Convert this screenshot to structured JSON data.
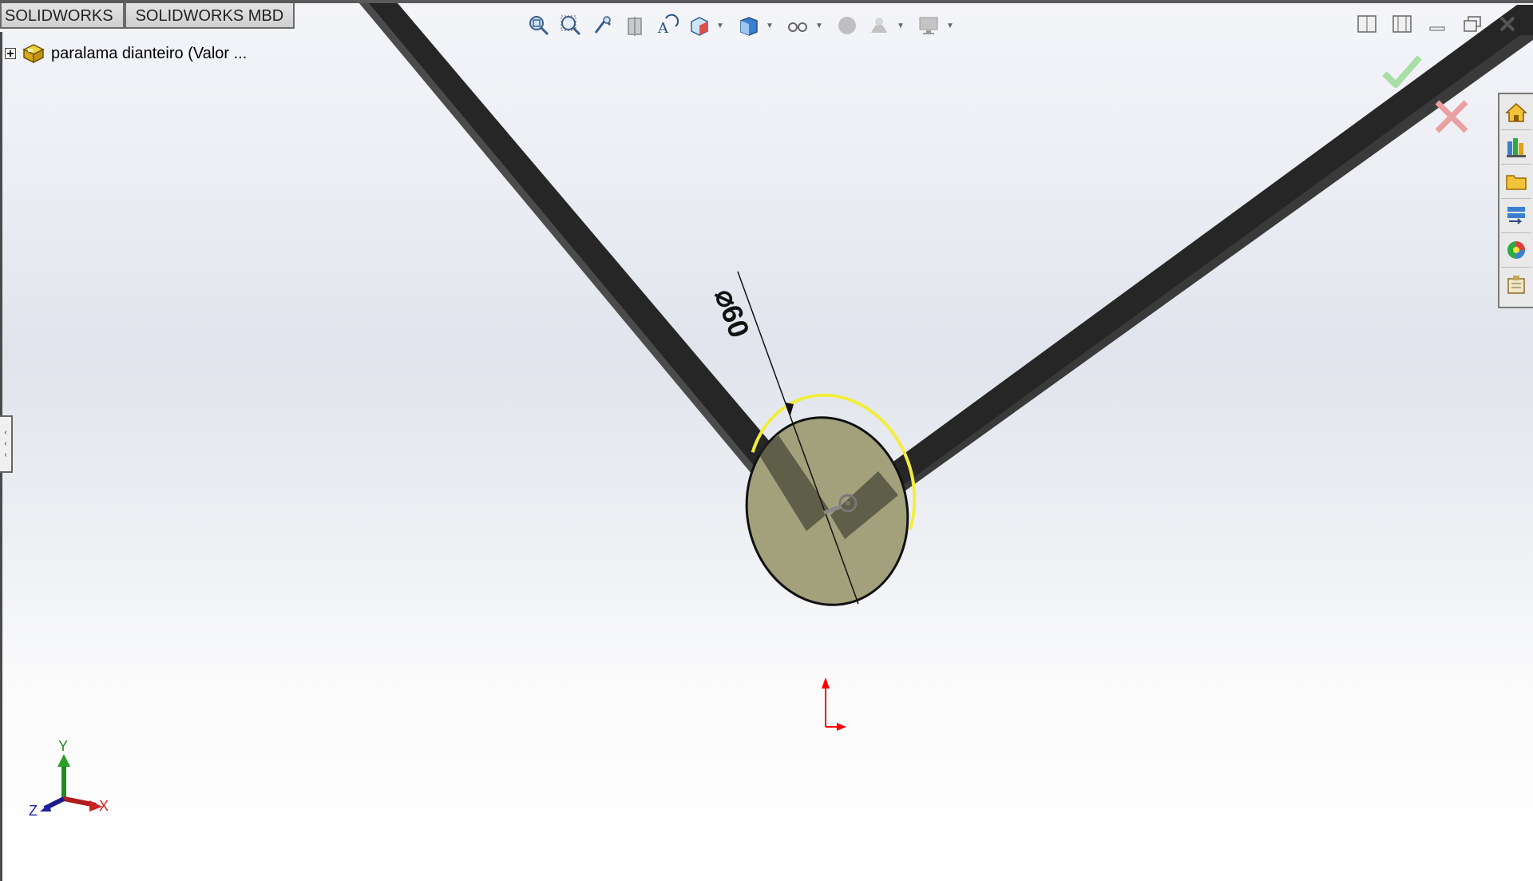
{
  "command_manager": {
    "tabs": [
      {
        "label": "SOLIDWORKS"
      },
      {
        "label": "SOLIDWORKS MBD"
      }
    ]
  },
  "feature_tree": {
    "root_label": "paralama dianteiro  (Valor ..."
  },
  "heads_up_toolbar": {
    "tools": [
      {
        "icon": "zoom-to-fit-icon"
      },
      {
        "icon": "zoom-to-area-icon"
      },
      {
        "icon": "previous-view-icon"
      },
      {
        "icon": "section-view-icon"
      },
      {
        "icon": "dynamic-annotation-views-icon"
      },
      {
        "icon": "view-orientation-icon"
      },
      {
        "icon": "display-style-icon"
      },
      {
        "icon": "hide-show-items-icon"
      },
      {
        "icon": "edit-appearance-icon"
      },
      {
        "icon": "apply-scene-icon"
      },
      {
        "icon": "view-settings-icon"
      }
    ]
  },
  "dimension": {
    "text": "⌀60"
  },
  "triad": {
    "x": "X",
    "y": "Y",
    "z": "Z"
  },
  "colors": {
    "beam": "#2b2b2b",
    "disk_fill": "#a3a17c",
    "selection_highlight": "#f2ee3c",
    "confirm_green": "#a9dfa6",
    "cancel_red": "#eaa0a0",
    "origin_red": "#ff0000"
  }
}
